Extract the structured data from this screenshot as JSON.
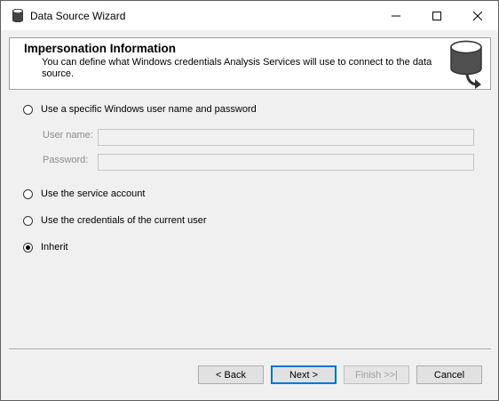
{
  "window": {
    "title": "Data Source Wizard",
    "controls": {
      "minimize": "minimize",
      "maximize": "maximize",
      "close": "close"
    }
  },
  "header": {
    "title": "Impersonation Information",
    "description": "You can define what Windows credentials Analysis Services will use to connect to the data source."
  },
  "options": {
    "specific_user": {
      "label": "Use a specific Windows user name and password",
      "checked": false
    },
    "user_name": {
      "label": "User name:",
      "value": ""
    },
    "password": {
      "label": "Password:",
      "value": ""
    },
    "service_account": {
      "label": "Use the service account",
      "checked": false
    },
    "current_user": {
      "label": "Use the credentials of the current user",
      "checked": false
    },
    "inherit": {
      "label": "Inherit",
      "checked": true
    }
  },
  "buttons": {
    "back": "< Back",
    "next": "Next >",
    "finish": "Finish >>|",
    "cancel": "Cancel"
  },
  "colors": {
    "accent": "#0078d7",
    "disabled_text": "#a0a0a0",
    "window_bg": "#f0f0f0"
  }
}
